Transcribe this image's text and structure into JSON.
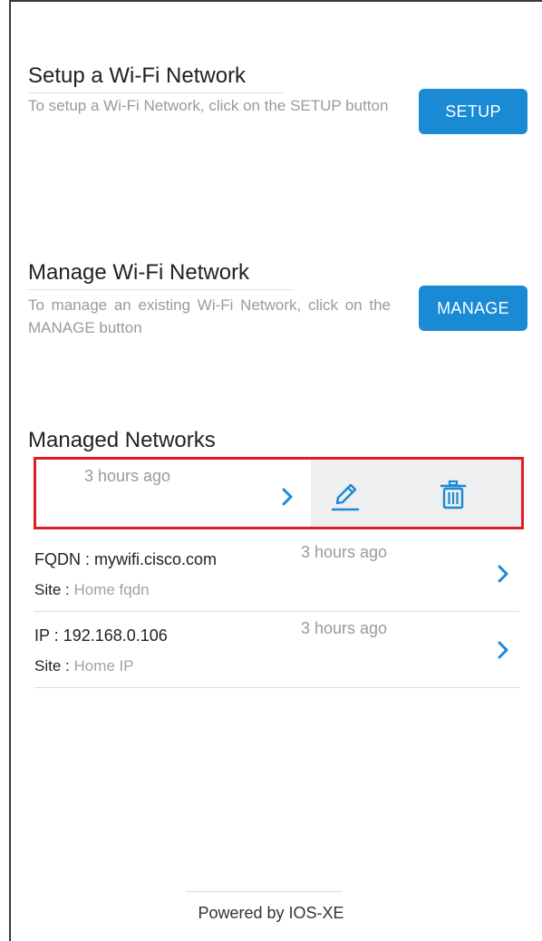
{
  "setup": {
    "title": "Setup a Wi-Fi Network",
    "description": "To setup a Wi-Fi Network, click on the SETUP button",
    "button_label": "SETUP"
  },
  "manage": {
    "title": "Manage Wi-Fi Network",
    "description": "To manage an existing Wi-Fi Network, click on the MANAGE button",
    "button_label": "MANAGE"
  },
  "managed_networks": {
    "title": "Managed Networks",
    "swiped_row": {
      "timestamp": "3 hours ago"
    },
    "rows": [
      {
        "primary": "FQDN : mywifi.cisco.com",
        "site_key": "Site :",
        "site_value": "Home fqdn",
        "timestamp": "3 hours ago"
      },
      {
        "primary": "IP : 192.168.0.106",
        "site_key": "Site :",
        "site_value": "Home IP",
        "timestamp": "3 hours ago"
      }
    ]
  },
  "footer": {
    "text": "Powered by IOS-XE"
  },
  "colors": {
    "accent": "#1a8ad4",
    "highlight": "#e01c24",
    "swipe_background": "#eeeff1"
  },
  "icons": {
    "chevron": "chevron-right-icon",
    "edit": "pencil-icon",
    "delete": "trash-icon"
  }
}
